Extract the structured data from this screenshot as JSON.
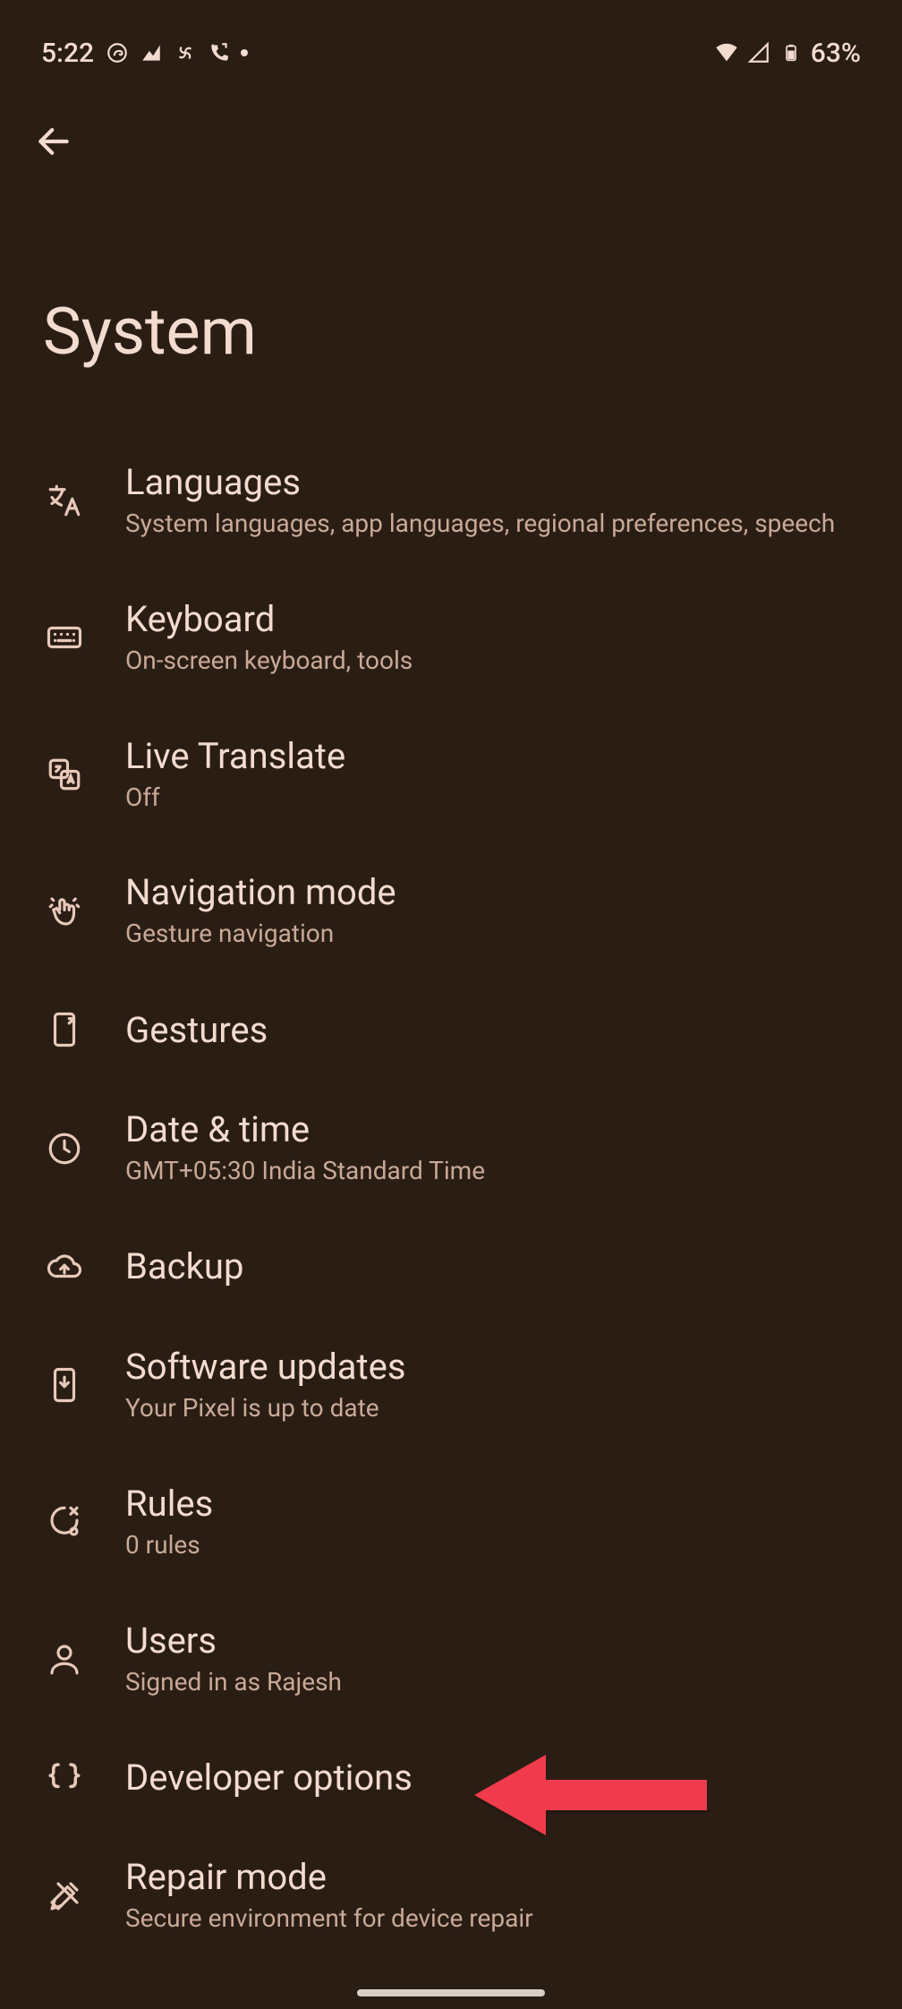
{
  "status": {
    "time": "5:22",
    "battery": "63%"
  },
  "header": {
    "title": "System"
  },
  "items": [
    {
      "title": "Languages",
      "sub": "System languages, app languages, regional preferences, speech",
      "name": "item-languages",
      "icon": "translate-icon"
    },
    {
      "title": "Keyboard",
      "sub": "On-screen keyboard, tools",
      "name": "item-keyboard",
      "icon": "keyboard-icon"
    },
    {
      "title": "Live Translate",
      "sub": "Off",
      "name": "item-live-translate",
      "icon": "live-translate-icon"
    },
    {
      "title": "Navigation mode",
      "sub": "Gesture navigation",
      "name": "item-navigation-mode",
      "icon": "gesture-icon"
    },
    {
      "title": "Gestures",
      "sub": "",
      "name": "item-gestures",
      "icon": "phone-gesture-icon"
    },
    {
      "title": "Date & time",
      "sub": "GMT+05:30 India Standard Time",
      "name": "item-date-time",
      "icon": "clock-icon"
    },
    {
      "title": "Backup",
      "sub": "",
      "name": "item-backup",
      "icon": "cloud-upload-icon"
    },
    {
      "title": "Software updates",
      "sub": "Your Pixel is up to date",
      "name": "item-software-updates",
      "icon": "phone-download-icon"
    },
    {
      "title": "Rules",
      "sub": "0 rules",
      "name": "item-rules",
      "icon": "rules-icon"
    },
    {
      "title": "Users",
      "sub": "Signed in as Rajesh",
      "name": "item-users",
      "icon": "person-icon"
    },
    {
      "title": "Developer options",
      "sub": "",
      "name": "item-developer-options",
      "icon": "braces-icon"
    },
    {
      "title": "Repair mode",
      "sub": "Secure environment for device repair",
      "name": "item-repair-mode",
      "icon": "tools-icon"
    }
  ]
}
